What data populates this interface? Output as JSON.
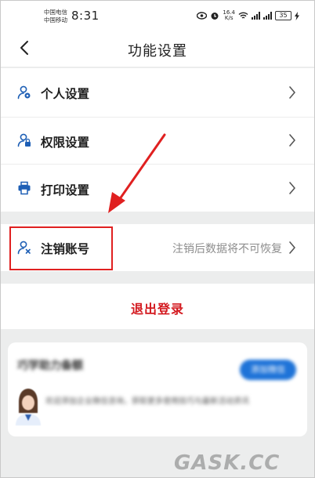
{
  "status_bar": {
    "carrier_1": "中国电信",
    "carrier_2": "中国移动",
    "time": "8:31",
    "net_speed": "16.4\nK/s",
    "battery": "35"
  },
  "nav": {
    "title": "功能设置"
  },
  "menu": {
    "items": [
      {
        "label": "个人设置",
        "icon": "person-settings-icon"
      },
      {
        "label": "权限设置",
        "icon": "permission-icon"
      },
      {
        "label": "打印设置",
        "icon": "printer-icon"
      }
    ],
    "cancel_account": {
      "label": "注销账号",
      "hint": "注销后数据将不可恢复",
      "icon": "person-remove-icon"
    }
  },
  "logout": {
    "label": "退出登录"
  },
  "promo": {
    "title": "巧学助力备额",
    "button": "添加微信",
    "text": "欢迎添加企业微信咨询，获取更多使用技巧与最新活动资讯"
  },
  "watermark": "GASK.CC",
  "colors": {
    "accent_red": "#d3191f",
    "annotation_red": "#e02020",
    "icon_blue": "#1e5fb5",
    "background": "#eceded"
  }
}
